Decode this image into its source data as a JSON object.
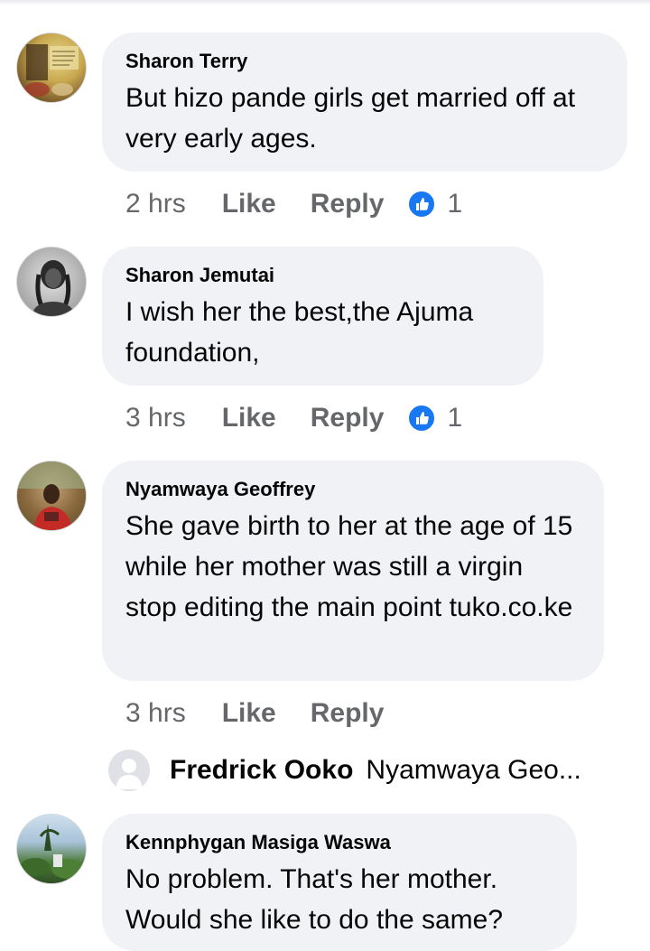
{
  "comments": [
    {
      "author": "Sharon Terry",
      "text": "But hizo pande girls get married off at very early ages.",
      "time": "2 hrs",
      "like_label": "Like",
      "reply_label": "Reply",
      "reaction_count": "1"
    },
    {
      "author": "Sharon Jemutai",
      "text": "I wish her the best,the Ajuma foundation,",
      "time": "3 hrs",
      "like_label": "Like",
      "reply_label": "Reply",
      "reaction_count": "1"
    },
    {
      "author": "Nyamwaya Geoffrey",
      "text": "She gave birth to her at the age of 15 while her mother was still a virgin stop editing the main point tuko.co.ke",
      "time": "3 hrs",
      "like_label": "Like",
      "reply_label": "Reply"
    },
    {
      "author": "Kennphygan Masiga Waswa",
      "text": "No problem. That's her mother. Would she  like to do the same?"
    }
  ],
  "reply_preview": {
    "author": "Fredrick Ooko",
    "snippet": "Nyamwaya Geo",
    "ellipsis": "..."
  },
  "colors": {
    "bubble": "#f0f2f5",
    "meta_text": "#65676b",
    "like_reaction": "#1877f2"
  },
  "icons": {
    "reaction": "like-thumb-icon",
    "placeholder_avatar": "default-avatar-icon"
  }
}
